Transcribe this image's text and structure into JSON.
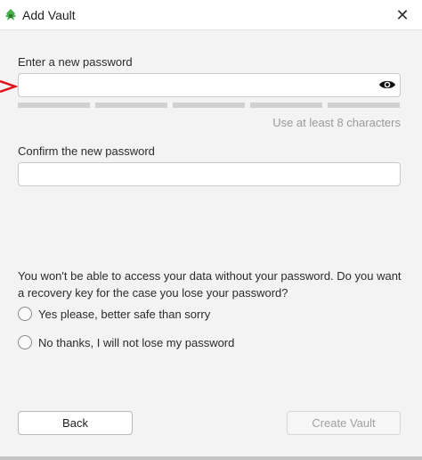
{
  "window": {
    "title": "Add Vault",
    "close_glyph": "✕",
    "app_icon": "cryptomator-icon"
  },
  "password": {
    "label": "Enter a new password",
    "value": "",
    "reveal_icon": "eye-icon",
    "strength_segments": 5,
    "hint": "Use at least 8 characters"
  },
  "confirm": {
    "label": "Confirm the new password",
    "value": ""
  },
  "recovery": {
    "question": "You won't be able to access your data without your password. Do you want a recovery key for the case you lose your password?",
    "options": [
      {
        "label": "Yes please, better safe than sorry",
        "selected": false
      },
      {
        "label": "No thanks, I will not lose my password",
        "selected": false
      }
    ]
  },
  "buttons": {
    "back": "Back",
    "create": "Create Vault",
    "create_enabled": false
  },
  "colors": {
    "accent_green": "#49b04a",
    "pointer_red": "#e0101a",
    "strength_gray": "#d1d1d1"
  }
}
